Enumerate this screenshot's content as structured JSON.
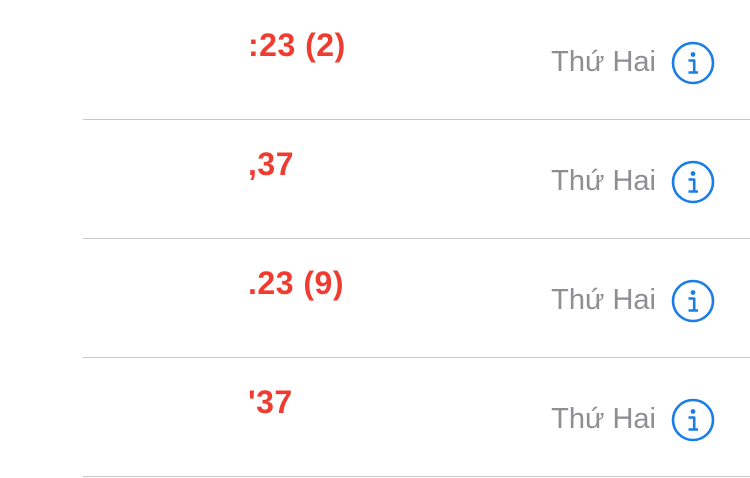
{
  "calls": [
    {
      "caller": ":23 (2)",
      "date": "Thứ Hai"
    },
    {
      "caller": ",37",
      "date": "Thứ Hai"
    },
    {
      "caller": ".23 (9)",
      "date": "Thứ Hai"
    },
    {
      "caller": "'37",
      "date": "Thứ Hai"
    }
  ],
  "icons": {
    "info": "info-circle-icon"
  },
  "colors": {
    "missed_call": "#f03b30",
    "accent": "#1a7ee6",
    "secondary_text": "#8e8e93",
    "divider": "#c8c7cc"
  }
}
